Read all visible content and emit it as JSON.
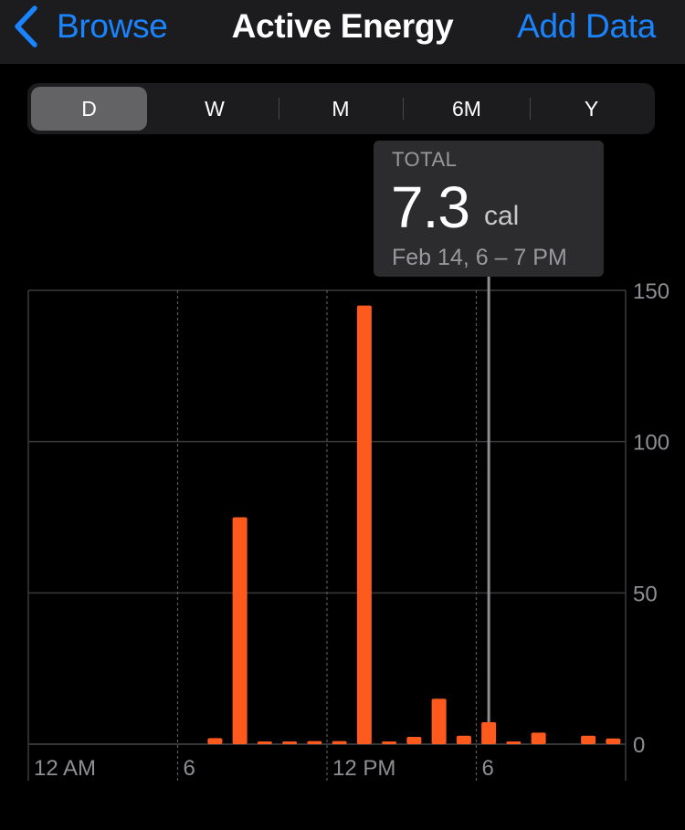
{
  "nav": {
    "back_label": "Browse",
    "title": "Active Energy",
    "action_label": "Add Data",
    "back_icon": "chevron-left-icon"
  },
  "segments": [
    "D",
    "W",
    "M",
    "6M",
    "Y"
  ],
  "selected_segment": "D",
  "tooltip": {
    "label": "TOTAL",
    "value": "7.3",
    "unit": "cal",
    "range": "Feb 14, 6 – 7 PM"
  },
  "colors": {
    "accent": "#1a84ff",
    "bar": "#ff5a1e"
  },
  "chart_data": {
    "type": "bar",
    "x": [
      0,
      1,
      2,
      3,
      4,
      5,
      6,
      7,
      8,
      9,
      10,
      11,
      12,
      13,
      14,
      15,
      16,
      17,
      18,
      19,
      20,
      21,
      22,
      23
    ],
    "values": [
      0,
      0,
      0,
      0,
      0,
      0,
      0,
      2,
      75,
      0.6,
      0.7,
      1,
      1,
      145,
      0.5,
      2.4,
      15,
      2.8,
      7.3,
      0.8,
      3.8,
      0,
      2.8,
      1.9
    ],
    "selected_index": 18,
    "x_tick_labels": [
      {
        "x": 0,
        "label": "12 AM"
      },
      {
        "x": 6,
        "label": "6"
      },
      {
        "x": 12,
        "label": "12 PM"
      },
      {
        "x": 18,
        "label": "6"
      }
    ],
    "y_ticks": [
      0,
      50,
      100,
      150
    ],
    "ylim": [
      0,
      150
    ],
    "grid": true
  }
}
